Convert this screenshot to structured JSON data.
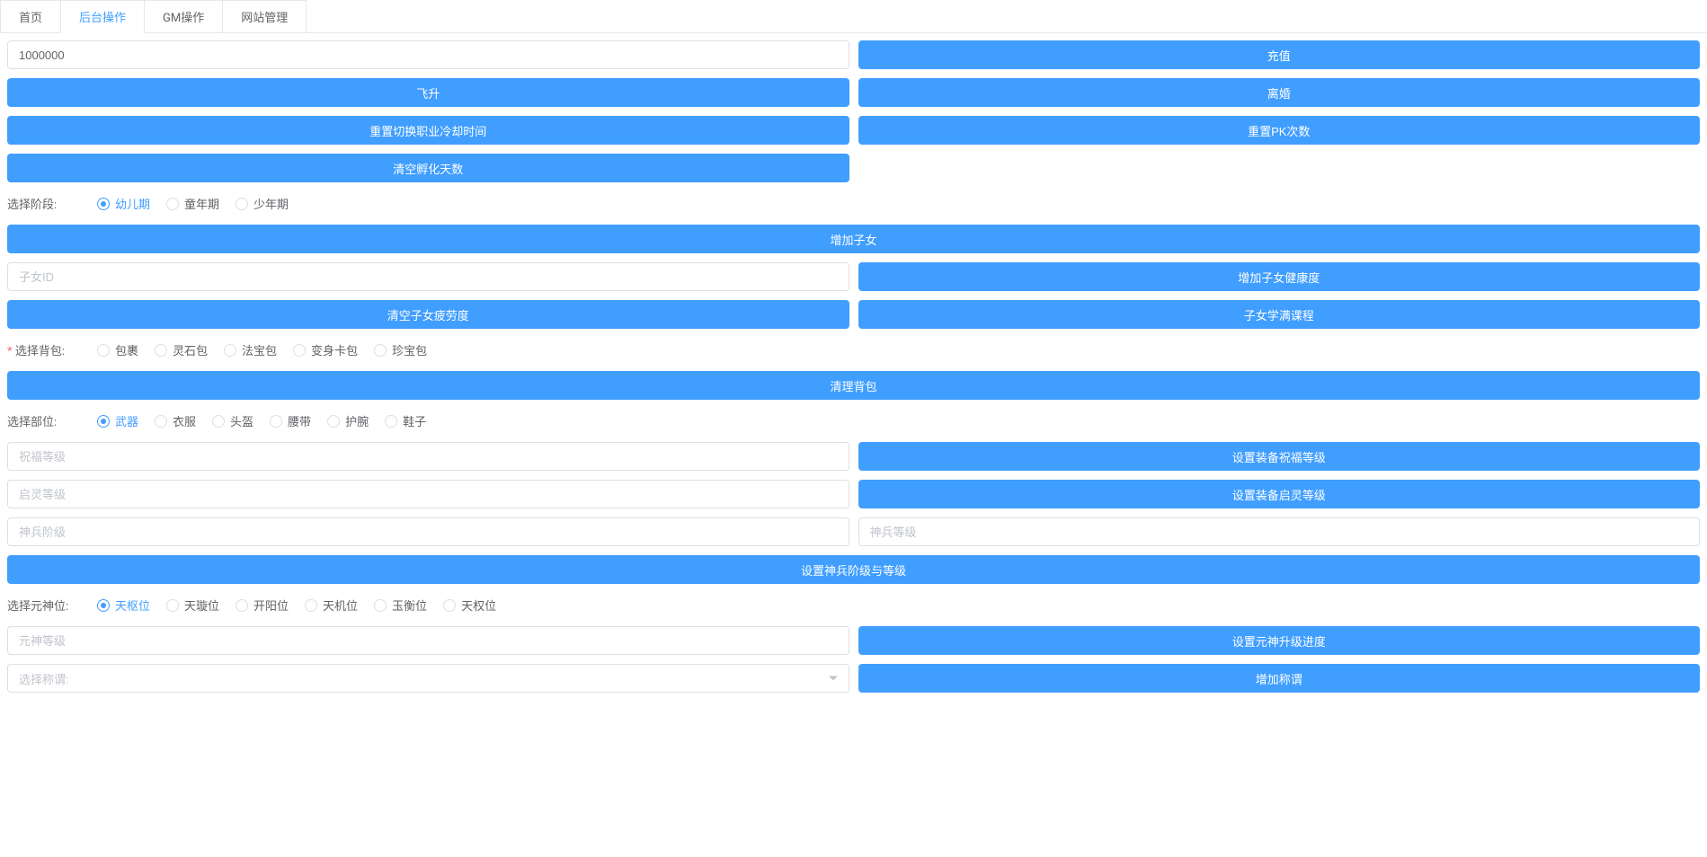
{
  "tabs": [
    {
      "label": "首页",
      "active": false
    },
    {
      "label": "后台操作",
      "active": true
    },
    {
      "label": "GM操作",
      "active": false
    },
    {
      "label": "网站管理",
      "active": false
    }
  ],
  "inputs": {
    "amount": "1000000",
    "child_id_placeholder": "子女ID",
    "blessing_placeholder": "祝福等级",
    "qiling_placeholder": "启灵等级",
    "shenbing_stage_placeholder": "神兵阶级",
    "shenbing_level_placeholder": "神兵等级",
    "yuanshen_placeholder": "元神等级",
    "title_select_placeholder": "选择称谓:"
  },
  "buttons": {
    "recharge": "充值",
    "ascend": "飞升",
    "divorce": "离婚",
    "reset_job_cd": "重置切换职业冷却时间",
    "reset_pk": "重置PK次数",
    "clear_hatch": "清空孵化天数",
    "add_child": "增加子女",
    "add_child_health": "增加子女健康度",
    "clear_child_fatigue": "清空子女疲劳度",
    "child_full_course": "子女学满课程",
    "clear_bag": "清理背包",
    "set_blessing": "设置装备祝福等级",
    "set_qiling": "设置装备启灵等级",
    "set_shenbing": "设置神兵阶级与等级",
    "set_yuanshen": "设置元神升级进度",
    "add_title": "增加称谓"
  },
  "labels": {
    "select_stage": "选择阶段:",
    "select_bag": "选择背包:",
    "select_part": "选择部位:",
    "select_yuanshen": "选择元神位:"
  },
  "radios": {
    "stage": [
      {
        "label": "幼儿期",
        "checked": true
      },
      {
        "label": "童年期",
        "checked": false
      },
      {
        "label": "少年期",
        "checked": false
      }
    ],
    "bag": [
      {
        "label": "包裹",
        "checked": false
      },
      {
        "label": "灵石包",
        "checked": false
      },
      {
        "label": "法宝包",
        "checked": false
      },
      {
        "label": "变身卡包",
        "checked": false
      },
      {
        "label": "珍宝包",
        "checked": false
      }
    ],
    "part": [
      {
        "label": "武器",
        "checked": true
      },
      {
        "label": "衣服",
        "checked": false
      },
      {
        "label": "头盔",
        "checked": false
      },
      {
        "label": "腰带",
        "checked": false
      },
      {
        "label": "护腕",
        "checked": false
      },
      {
        "label": "鞋子",
        "checked": false
      }
    ],
    "yuanshen": [
      {
        "label": "天枢位",
        "checked": true
      },
      {
        "label": "天璇位",
        "checked": false
      },
      {
        "label": "开阳位",
        "checked": false
      },
      {
        "label": "天机位",
        "checked": false
      },
      {
        "label": "玉衡位",
        "checked": false
      },
      {
        "label": "天权位",
        "checked": false
      }
    ]
  }
}
